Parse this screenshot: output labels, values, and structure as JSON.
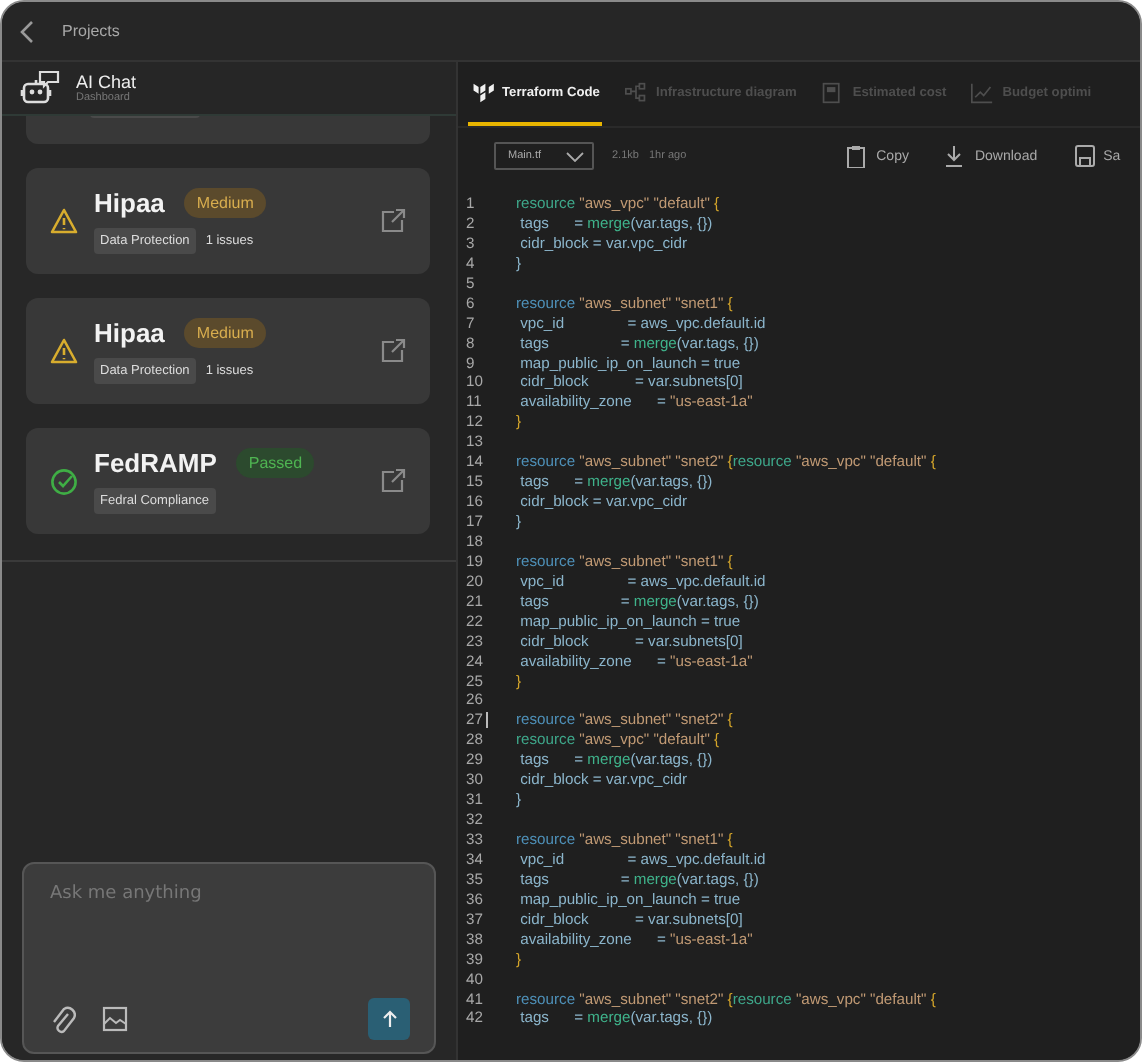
{
  "header": {
    "title": "Projects"
  },
  "chat": {
    "title": "AI Chat",
    "subtitle": "Dashboard"
  },
  "compliance_cards": [
    {
      "title": "Hipaa",
      "status": "Medium",
      "kind": "warning",
      "tags": [
        "Data Protection"
      ],
      "issues": "1 issues"
    },
    {
      "title": "Hipaa",
      "status": "Medium",
      "kind": "warning",
      "tags": [
        "Data Protection"
      ],
      "issues": "1 issues"
    },
    {
      "title": "FedRAMP",
      "status": "Passed",
      "kind": "passed",
      "tags": [
        "Fedral Compliance"
      ]
    }
  ],
  "chat_input": {
    "placeholder": "Ask me anything"
  },
  "tabs": [
    {
      "label": "Terraform Code",
      "selected": true
    },
    {
      "label": "Infrastructure diagram",
      "selected": false
    },
    {
      "label": "Estimated cost",
      "selected": false
    },
    {
      "label": "Budget optimi",
      "selected": false
    }
  ],
  "file": {
    "name": "Main.tf",
    "size": "2.1kb",
    "modified": "1hr ago"
  },
  "actions": [
    "Copy",
    "Download",
    "Sa"
  ],
  "code": {
    "lines": [
      {
        "number": "1",
        "cursor": false,
        "tokens": [
          {
            "kind": "kw2",
            "text": "resource"
          },
          {
            "kind": "str",
            "text": " \"aws_vpc\" \"default\" "
          },
          {
            "kind": "brace",
            "text": "{"
          }
        ]
      },
      {
        "number": "2",
        "cursor": false,
        "tokens": [
          {
            "kind": "plain",
            "text": " tags      = "
          },
          {
            "kind": "fn",
            "text": "merge"
          },
          {
            "kind": "plain",
            "text": "(var.tags, {})"
          }
        ]
      },
      {
        "number": "3",
        "cursor": false,
        "tokens": [
          {
            "kind": "plain",
            "text": " cidr_block = var.vpc_cidr"
          }
        ]
      },
      {
        "number": "4",
        "cursor": false,
        "tokens": [
          {
            "kind": "plain",
            "text": "}"
          }
        ]
      },
      {
        "number": "5",
        "cursor": false
      },
      {
        "number": "6",
        "cursor": false,
        "tokens": [
          {
            "kind": "kw",
            "text": "resource"
          },
          {
            "kind": "str",
            "text": " \"aws_subnet\" \"snet1\" "
          },
          {
            "kind": "brace",
            "text": "{"
          }
        ]
      },
      {
        "number": "7",
        "cursor": false,
        "tokens": [
          {
            "kind": "plain",
            "text": " vpc_id               = aws_vpc.default.id"
          }
        ]
      },
      {
        "number": "8",
        "cursor": false,
        "tokens": [
          {
            "kind": "plain",
            "text": " tags                 = "
          },
          {
            "kind": "fn",
            "text": "merge"
          },
          {
            "kind": "plain",
            "text": "(var.tags, {})"
          }
        ]
      },
      {
        "number": "9",
        "cursor": false,
        "tokens": [
          {
            "kind": "plain",
            "text": " map_public_ip_on_launch = true"
          }
        ]
      },
      {
        "number": "10",
        "cursor": false,
        "tokens": [
          {
            "kind": "plain",
            "text": " cidr_block           = var.subnets[0]"
          }
        ]
      },
      {
        "number": "11",
        "cursor": false,
        "tokens": [
          {
            "kind": "plain",
            "text": " availability_zone      = "
          },
          {
            "kind": "str",
            "text": "\"us-east-1a\""
          }
        ]
      },
      {
        "number": "12",
        "cursor": false,
        "tokens": [
          {
            "kind": "brace",
            "text": "}"
          }
        ]
      },
      {
        "number": "13",
        "cursor": false
      },
      {
        "number": "14",
        "cursor": false,
        "tokens": [
          {
            "kind": "kw",
            "text": "resource"
          },
          {
            "kind": "str",
            "text": " \"aws_subnet\" \"snet2\" "
          },
          {
            "kind": "brace",
            "text": "{"
          },
          {
            "kind": "kw2",
            "text": "resource"
          },
          {
            "kind": "str",
            "text": " \"aws_vpc\" \"default\" "
          },
          {
            "kind": "brace",
            "text": "{"
          }
        ]
      },
      {
        "number": "15",
        "cursor": false,
        "tokens": [
          {
            "kind": "plain",
            "text": " tags      = "
          },
          {
            "kind": "fn",
            "text": "merge"
          },
          {
            "kind": "plain",
            "text": "(var.tags, {})"
          }
        ]
      },
      {
        "number": "16",
        "cursor": false,
        "tokens": [
          {
            "kind": "plain",
            "text": " cidr_block = var.vpc_cidr"
          }
        ]
      },
      {
        "number": "17",
        "cursor": false,
        "tokens": [
          {
            "kind": "plain",
            "text": "}"
          }
        ]
      },
      {
        "number": "18",
        "cursor": false
      },
      {
        "number": "19",
        "cursor": false,
        "tokens": [
          {
            "kind": "kw",
            "text": "resource"
          },
          {
            "kind": "str",
            "text": " \"aws_subnet\" \"snet1\" "
          },
          {
            "kind": "brace",
            "text": "{"
          }
        ]
      },
      {
        "number": "20",
        "cursor": false,
        "tokens": [
          {
            "kind": "plain",
            "text": " vpc_id               = aws_vpc.default.id"
          }
        ]
      },
      {
        "number": "21",
        "cursor": false,
        "tokens": [
          {
            "kind": "plain",
            "text": " tags                 = "
          },
          {
            "kind": "fn",
            "text": "merge"
          },
          {
            "kind": "plain",
            "text": "(var.tags, {})"
          }
        ]
      },
      {
        "number": "22",
        "cursor": false,
        "tokens": [
          {
            "kind": "plain",
            "text": " map_public_ip_on_launch = true"
          }
        ]
      },
      {
        "number": "23",
        "cursor": false,
        "tokens": [
          {
            "kind": "plain",
            "text": " cidr_block           = var.subnets[0]"
          }
        ]
      },
      {
        "number": "24",
        "cursor": false,
        "tokens": [
          {
            "kind": "plain",
            "text": " availability_zone      = "
          },
          {
            "kind": "str",
            "text": "\"us-east-1a\""
          }
        ]
      },
      {
        "number": "25",
        "cursor": false,
        "tokens": [
          {
            "kind": "brace",
            "text": "}"
          }
        ]
      },
      {
        "number": "26",
        "cursor": false
      },
      {
        "number": "27",
        "cursor": true,
        "tokens": [
          {
            "kind": "kw",
            "text": "resource"
          },
          {
            "kind": "str",
            "text": " \"aws_subnet\" \"snet2\" "
          },
          {
            "kind": "brace",
            "text": "{"
          }
        ]
      },
      {
        "number": "28",
        "cursor": false,
        "tokens": [
          {
            "kind": "kw2",
            "text": "resource"
          },
          {
            "kind": "str",
            "text": " \"aws_vpc\" \"default\" "
          },
          {
            "kind": "brace",
            "text": "{"
          }
        ]
      },
      {
        "number": "29",
        "cursor": false,
        "tokens": [
          {
            "kind": "plain",
            "text": " tags      = "
          },
          {
            "kind": "fn",
            "text": "merge"
          },
          {
            "kind": "plain",
            "text": "(var.tags, {})"
          }
        ]
      },
      {
        "number": "30",
        "cursor": false,
        "tokens": [
          {
            "kind": "plain",
            "text": " cidr_block = var.vpc_cidr"
          }
        ]
      },
      {
        "number": "31",
        "cursor": false,
        "tokens": [
          {
            "kind": "plain",
            "text": "}"
          }
        ]
      },
      {
        "number": "32",
        "cursor": false
      },
      {
        "number": "33",
        "cursor": false,
        "tokens": [
          {
            "kind": "kw",
            "text": "resource"
          },
          {
            "kind": "str",
            "text": " \"aws_subnet\" \"snet1\" "
          },
          {
            "kind": "brace",
            "text": "{"
          }
        ]
      },
      {
        "number": "34",
        "cursor": false,
        "tokens": [
          {
            "kind": "plain",
            "text": " vpc_id               = aws_vpc.default.id"
          }
        ]
      },
      {
        "number": "35",
        "cursor": false,
        "tokens": [
          {
            "kind": "plain",
            "text": " tags                 = "
          },
          {
            "kind": "fn",
            "text": "merge"
          },
          {
            "kind": "plain",
            "text": "(var.tags, {})"
          }
        ]
      },
      {
        "number": "36",
        "cursor": false,
        "tokens": [
          {
            "kind": "plain",
            "text": " map_public_ip_on_launch = true"
          }
        ]
      },
      {
        "number": "37",
        "cursor": false,
        "tokens": [
          {
            "kind": "plain",
            "text": " cidr_block           = var.subnets[0]"
          }
        ]
      },
      {
        "number": "38",
        "cursor": false,
        "tokens": [
          {
            "kind": "plain",
            "text": " availability_zone      = "
          },
          {
            "kind": "str",
            "text": "\"us-east-1a\""
          }
        ]
      },
      {
        "number": "39",
        "cursor": false,
        "tokens": [
          {
            "kind": "brace",
            "text": "}"
          }
        ]
      },
      {
        "number": "40",
        "cursor": false
      },
      {
        "number": "41",
        "cursor": false,
        "tokens": [
          {
            "kind": "kw",
            "text": "resource"
          },
          {
            "kind": "str",
            "text": " \"aws_subnet\" \"snet2\" "
          },
          {
            "kind": "brace",
            "text": "{"
          },
          {
            "kind": "kw2",
            "text": "resource"
          },
          {
            "kind": "str",
            "text": " \"aws_vpc\" \"default\" "
          },
          {
            "kind": "brace",
            "text": "{"
          }
        ]
      },
      {
        "number": "42",
        "cursor": false,
        "tokens": [
          {
            "kind": "plain",
            "text": " tags      = "
          },
          {
            "kind": "fn",
            "text": "merge"
          },
          {
            "kind": "plain",
            "text": "(var.tags, {})"
          }
        ]
      }
    ]
  }
}
